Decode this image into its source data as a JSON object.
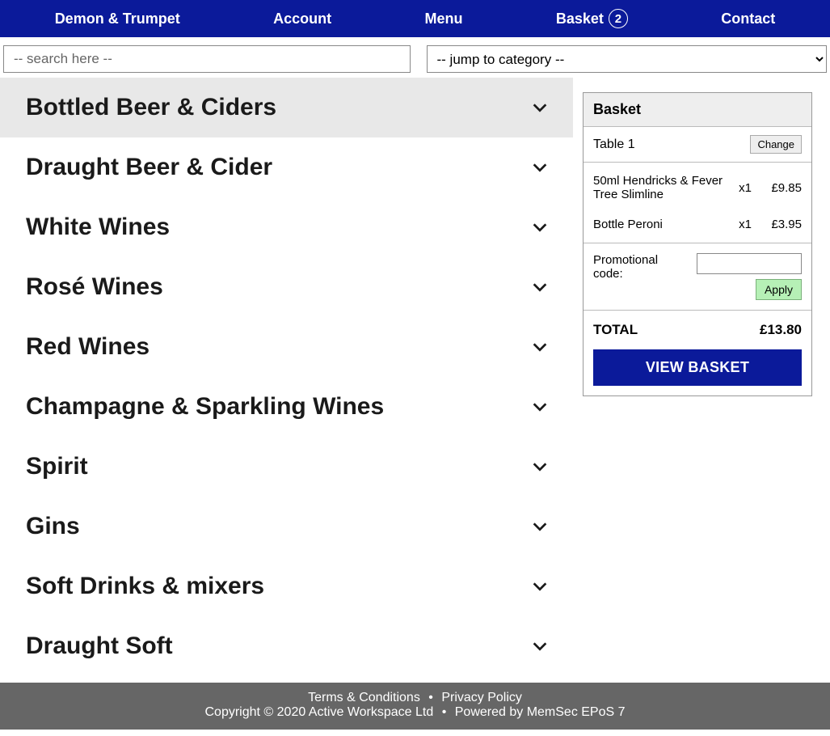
{
  "nav": {
    "brand": "Demon & Trumpet",
    "account": "Account",
    "menu": "Menu",
    "basket_label": "Basket",
    "basket_count": "2",
    "contact": "Contact"
  },
  "search": {
    "placeholder": "-- search here --"
  },
  "category_select": {
    "placeholder": "-- jump to category --"
  },
  "categories": [
    {
      "label": "Bottled Beer & Ciders",
      "active": true
    },
    {
      "label": "Draught Beer & Cider",
      "active": false
    },
    {
      "label": "White Wines",
      "active": false
    },
    {
      "label": "Rosé Wines",
      "active": false
    },
    {
      "label": "Red Wines",
      "active": false
    },
    {
      "label": "Champagne & Sparkling Wines",
      "active": false
    },
    {
      "label": "Spirit",
      "active": false
    },
    {
      "label": "Gins",
      "active": false
    },
    {
      "label": "Soft Drinks & mixers",
      "active": false
    },
    {
      "label": "Draught Soft",
      "active": false
    }
  ],
  "basket": {
    "header": "Basket",
    "table_label": "Table",
    "table_number": "1",
    "change_label": "Change",
    "items": [
      {
        "name": "50ml Hendricks & Fever Tree Slimline",
        "qty": "x1",
        "price": "£9.85"
      },
      {
        "name": "Bottle Peroni",
        "qty": "x1",
        "price": "£3.95"
      }
    ],
    "promo_label": "Promotional code:",
    "apply_label": "Apply",
    "total_label": "TOTAL",
    "total_value": "£13.80",
    "view_label": "VIEW BASKET"
  },
  "footer": {
    "terms": "Terms & Conditions",
    "privacy": "Privacy Policy",
    "copyright": "Copyright © 2020 Active Workspace Ltd",
    "powered": "Powered by MemSec EPoS 7"
  }
}
